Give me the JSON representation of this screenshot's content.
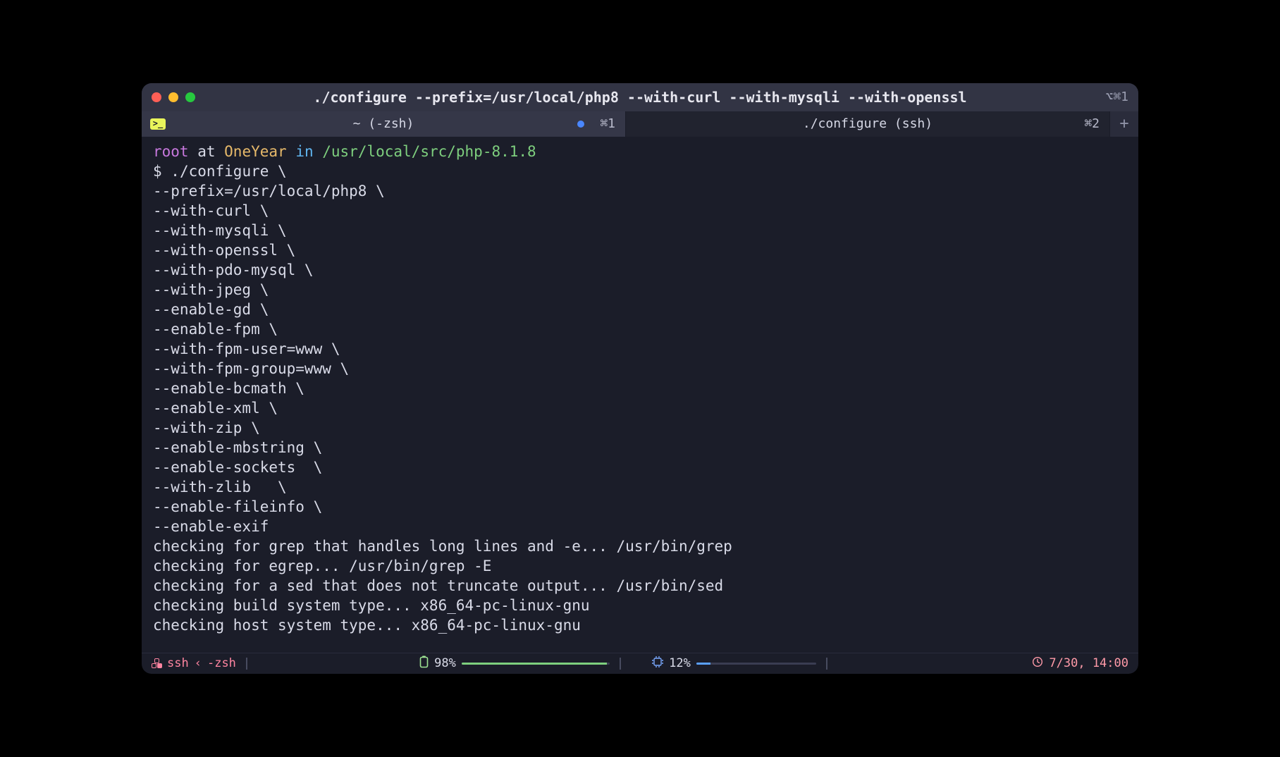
{
  "window": {
    "title": "./configure --prefix=/usr/local/php8 --with-curl --with-mysqli --with-openssl",
    "right_hint": "⌥⌘1"
  },
  "tabs": [
    {
      "label": "~ (-zsh)",
      "shortcut": "⌘1",
      "has_indicator": true,
      "has_icon": true,
      "active": false
    },
    {
      "label": "./configure (ssh)",
      "shortcut": "⌘2",
      "has_indicator": false,
      "has_icon": false,
      "active": true
    }
  ],
  "new_tab_glyph": "+",
  "prompt": {
    "user": "root",
    "at": " at ",
    "host": "OneYear",
    "in": " in ",
    "path": "/usr/local/src/php-8.1.8",
    "ps1": "$ "
  },
  "command_lines": [
    "./configure \\",
    "--prefix=/usr/local/php8 \\",
    "--with-curl \\",
    "--with-mysqli \\",
    "--with-openssl \\",
    "--with-pdo-mysql \\",
    "--with-jpeg \\",
    "--enable-gd \\",
    "--enable-fpm \\",
    "--with-fpm-user=www \\",
    "--with-fpm-group=www \\",
    "--enable-bcmath \\",
    "--enable-xml \\",
    "--with-zip \\",
    "--enable-mbstring \\",
    "--enable-sockets  \\",
    "--with-zlib   \\",
    "--enable-fileinfo \\",
    "--enable-exif"
  ],
  "output_lines": [
    "checking for grep that handles long lines and -e... /usr/bin/grep",
    "checking for egrep... /usr/bin/grep -E",
    "checking for a sed that does not truncate output... /usr/bin/sed",
    "checking build system type... x86_64-pc-linux-gnu",
    "checking host system type... x86_64-pc-linux-gnu"
  ],
  "status": {
    "session": "ssh",
    "separator": "‹",
    "process": "-zsh",
    "battery_pct": "98%",
    "battery_fill": 98,
    "cpu_pct": "12%",
    "clock": "7/30, 14:00"
  },
  "icons": {
    "terminal_glyph": ">_",
    "battery_glyph": "▯",
    "cpu_glyph": "⌗",
    "clock_glyph": "◷"
  }
}
